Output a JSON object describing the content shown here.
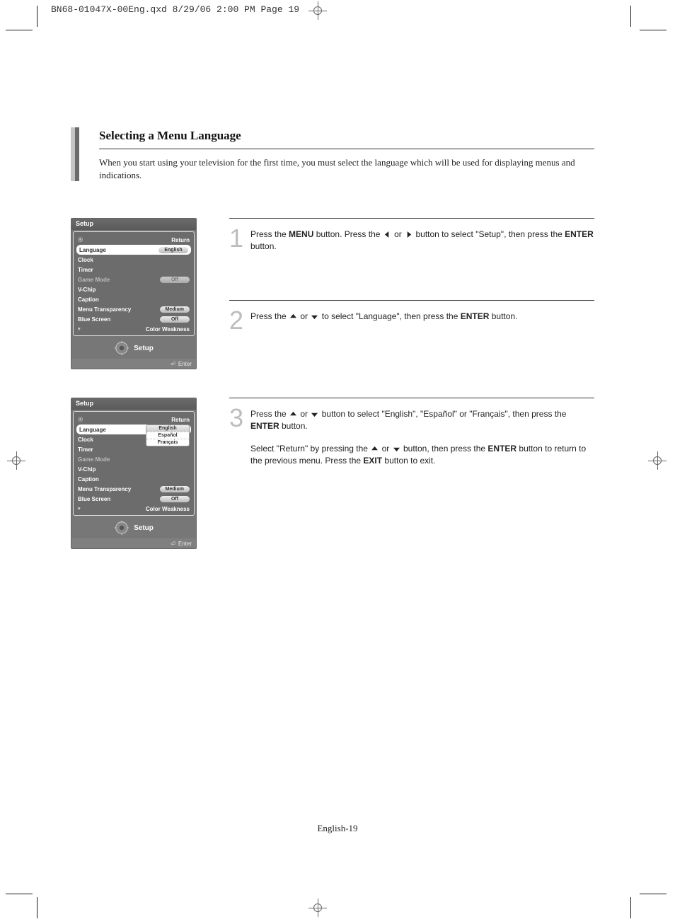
{
  "print_header": "BN68-01047X-00Eng.qxd  8/29/06  2:00 PM  Page 19",
  "section": {
    "title": "Selecting a Menu Language",
    "intro": "When you start using your television for the first time, you must select the language which will be used for displaying menus and indications."
  },
  "steps": {
    "s1": {
      "num": "1",
      "pre1": "Press the ",
      "b1": "MENU",
      "mid1": " button. Press the ",
      "mid2": " or ",
      "mid3": " button to select \"Setup\", then press the ",
      "b2": "ENTER",
      "post": " button."
    },
    "s2": {
      "num": "2",
      "pre1": "Press the ",
      "mid1": " or ",
      "mid2": " to select \"Language\", then press the ",
      "b1": "ENTER",
      "post": " button."
    },
    "s3": {
      "num": "3",
      "pre1": "Press the ",
      "mid1": " or ",
      "mid2": " button to select \"English\", \"Español\" or \"Français\", then press the ",
      "b1": "ENTER",
      "post": " button.",
      "p2_pre": "Select \"Return\" by pressing the ",
      "p2_mid1": " or ",
      "p2_mid2": " button, then press the ",
      "p2_b1": "ENTER",
      "p2_mid3": " button to return to the previous menu. Press the ",
      "p2_b2": "EXIT",
      "p2_post": " button to exit."
    }
  },
  "osd1": {
    "title": "Setup",
    "return": "Return",
    "rows": [
      {
        "label": "Language",
        "value": "English",
        "selected": true
      },
      {
        "label": "Clock"
      },
      {
        "label": "Timer"
      },
      {
        "label": "Game Mode",
        "value": "Off",
        "dim": true
      },
      {
        "label": "V-Chip"
      },
      {
        "label": "Caption"
      },
      {
        "label": "Menu Transparency",
        "value": "Medium"
      },
      {
        "label": "Blue Screen",
        "value": "Off"
      },
      {
        "label": "Color Weakness",
        "arrow": true
      }
    ],
    "bottom_label": "Setup",
    "footer": "Enter"
  },
  "osd2": {
    "title": "Setup",
    "return": "Return",
    "rows_top": [
      {
        "label": "Language",
        "selected": true
      }
    ],
    "dropdown": [
      "English",
      "Español",
      "Français"
    ],
    "rows_mid": [
      {
        "label": "Clock"
      },
      {
        "label": "Timer"
      },
      {
        "label": "Game Mode",
        "dim": true
      },
      {
        "label": "V-Chip"
      },
      {
        "label": "Caption"
      },
      {
        "label": "Menu Transparency",
        "value": "Medium"
      },
      {
        "label": "Blue Screen",
        "value": "Off"
      },
      {
        "label": "Color Weakness",
        "arrow": true
      }
    ],
    "bottom_label": "Setup",
    "footer": "Enter"
  },
  "page_number": "English-19"
}
